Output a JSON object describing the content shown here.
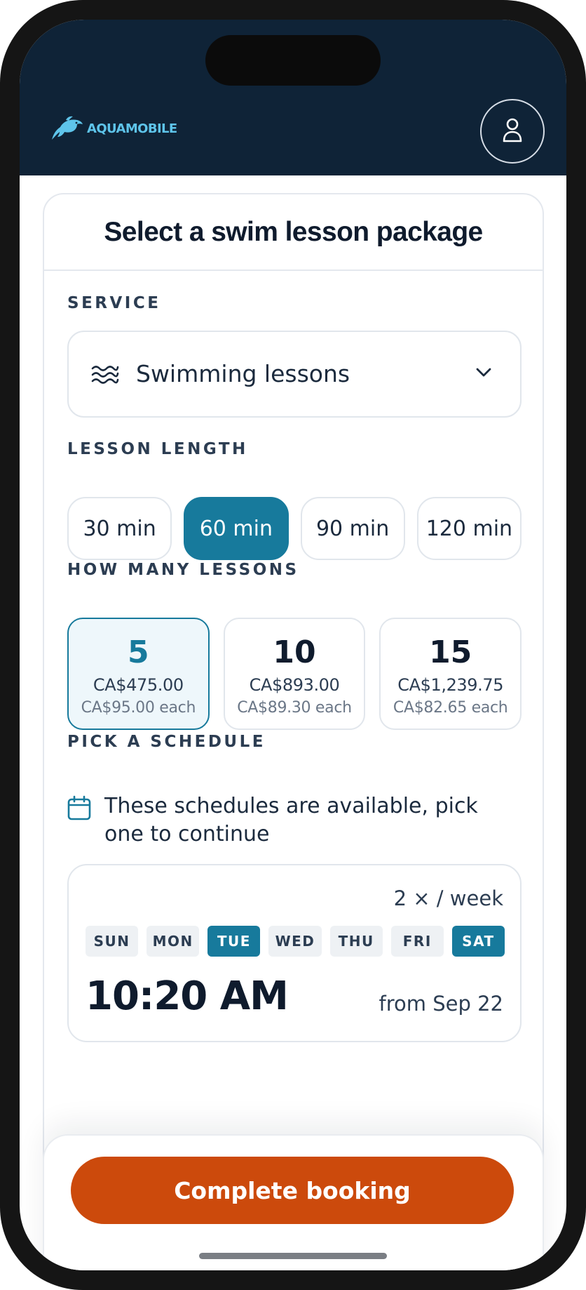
{
  "app": {
    "brand_name": "AQUAMOBILE"
  },
  "header": {
    "logo_icon": "dolphin-icon",
    "profile_icon": "user-icon"
  },
  "page": {
    "title": "Select a swim lesson package"
  },
  "service": {
    "label": "SERVICE",
    "icon": "waves-icon",
    "selected": "Swimming lessons",
    "dropdown_icon": "chevron-down-icon"
  },
  "lesson_length": {
    "label": "LESSON LENGTH",
    "options": [
      "30 min",
      "60 min",
      "90 min",
      "120 min"
    ],
    "selected": "60 min"
  },
  "lessons": {
    "label": "HOW MANY LESSONS",
    "options": [
      {
        "count": "5",
        "total": "CA$475.00",
        "each": "CA$95.00 each",
        "selected": true
      },
      {
        "count": "10",
        "total": "CA$893.00",
        "each": "CA$89.30 each",
        "selected": false
      },
      {
        "count": "15",
        "total": "CA$1,239.75",
        "each": "CA$82.65 each",
        "selected": false
      }
    ]
  },
  "schedule": {
    "label": "PICK A SCHEDULE",
    "icon": "calendar-icon",
    "note": "These schedules are available, pick one to continue",
    "option": {
      "frequency": "2 × / week",
      "days": [
        "SUN",
        "MON",
        "TUE",
        "WED",
        "THU",
        "FRI",
        "SAT"
      ],
      "active_days": [
        "TUE",
        "SAT"
      ],
      "time": "10:20 AM",
      "start": "from Sep 22"
    }
  },
  "footer": {
    "cta_label": "Complete booking"
  },
  "colors": {
    "header_bg": "#0f2337",
    "accent": "#177a9c",
    "cta": "#cc4a0c",
    "brand": "#5ec4ea"
  }
}
